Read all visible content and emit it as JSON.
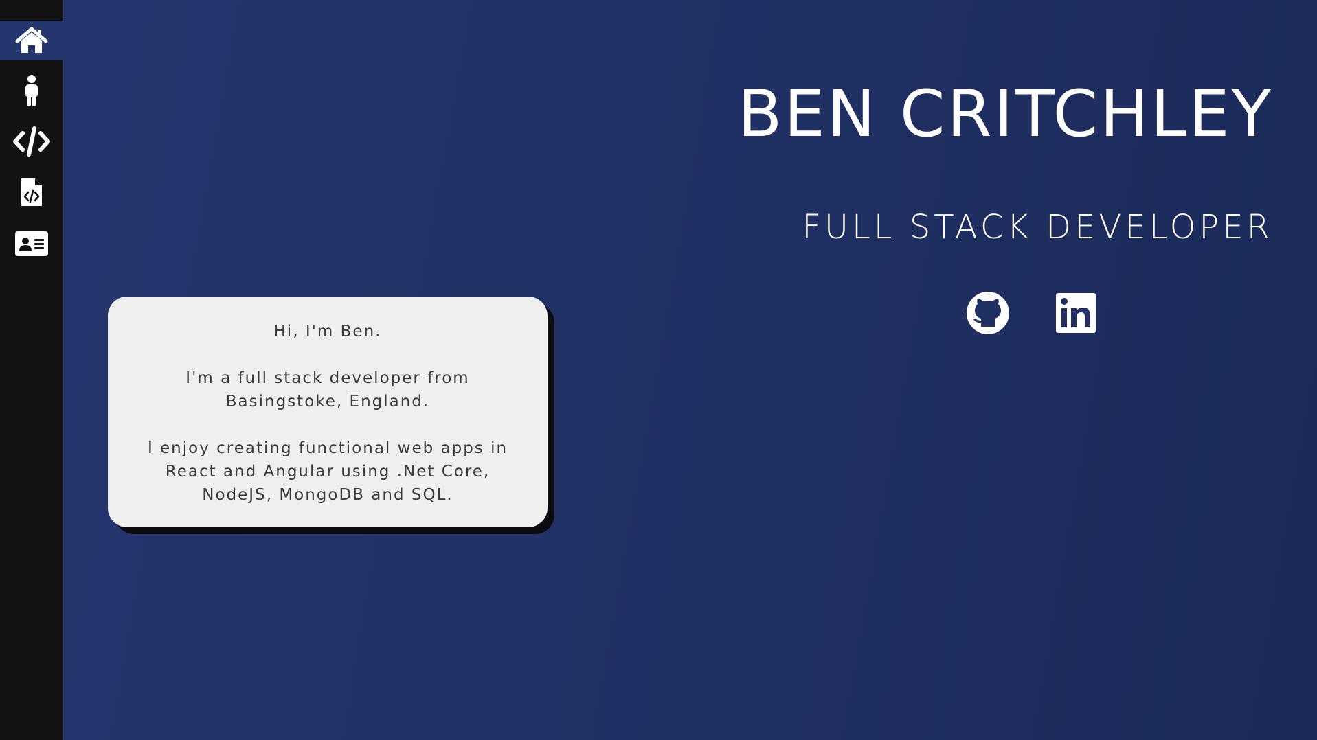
{
  "colors": {
    "background_start": "#25366f",
    "background_end": "#1b2a58",
    "sidebar": "#121212",
    "active_nav": "#25366f",
    "card": "#efefef",
    "card_text": "#3a3a3a",
    "card_shadow": "#0c0c10",
    "text_light": "#ffffff"
  },
  "sidebar": {
    "items": [
      {
        "icon": "home-icon",
        "active": true
      },
      {
        "icon": "person-icon",
        "active": false
      },
      {
        "icon": "code-icon",
        "active": false
      },
      {
        "icon": "code-file-icon",
        "active": false
      },
      {
        "icon": "contact-card-icon",
        "active": false
      }
    ]
  },
  "hero": {
    "name": "BEN CRITCHLEY",
    "title": "FULL STACK DEVELOPER"
  },
  "social": {
    "items": [
      {
        "icon": "github-icon"
      },
      {
        "icon": "linkedin-icon"
      }
    ]
  },
  "about": {
    "paragraphs": [
      "Hi, I'm Ben.",
      "I'm a full stack developer from Basingstoke, England.",
      "I enjoy creating functional web apps in React and Angular using .Net Core, NodeJS, MongoDB and SQL."
    ]
  }
}
